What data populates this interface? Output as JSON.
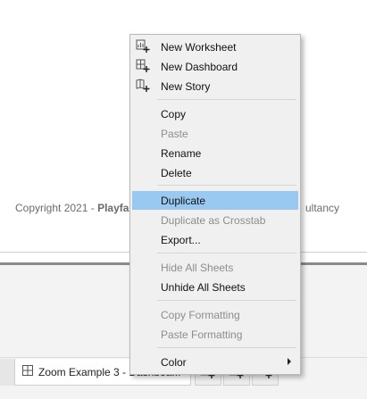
{
  "footer": {
    "copyright_prefix": "Copyright 2021 - ",
    "copyright_bold": "Playfa",
    "copyright_tail": "ultancy"
  },
  "tabs": {
    "active_label": "Zoom Example 3 - Dashboa..."
  },
  "menu": {
    "new_worksheet": "New Worksheet",
    "new_dashboard": "New Dashboard",
    "new_story": "New Story",
    "copy": "Copy",
    "paste": "Paste",
    "rename": "Rename",
    "delete": "Delete",
    "duplicate": "Duplicate",
    "duplicate_crosstab": "Duplicate as Crosstab",
    "export": "Export...",
    "hide_all": "Hide All Sheets",
    "unhide_all": "Unhide All Sheets",
    "copy_formatting": "Copy Formatting",
    "paste_formatting": "Paste Formatting",
    "color": "Color"
  },
  "icons": {
    "new_worksheet": "new-worksheet-icon",
    "new_dashboard": "new-dashboard-icon",
    "new_story": "new-story-icon",
    "dashboard_tab": "dashboard-icon"
  },
  "colors": {
    "highlight": "#99c9f1",
    "disabled_text": "#8d8d8d"
  }
}
